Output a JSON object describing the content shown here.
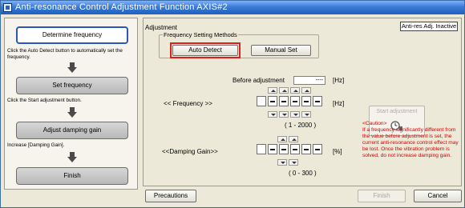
{
  "window": {
    "title": "Anti-resonance Control Adjustment Function AXIS#2"
  },
  "procedure": {
    "steps": [
      {
        "label": "Determine frequency",
        "note": "Click the Auto Detect button to automatically set the frequency."
      },
      {
        "label": "Set frequency",
        "note": "Click the Start adjustment button."
      },
      {
        "label": "Adjust damping gain",
        "note": "Increase [Damping Gain]."
      },
      {
        "label": "Finish",
        "note": ""
      }
    ]
  },
  "adjustment": {
    "title": "Adjustment",
    "status": "Anti-res Adj. Inactive",
    "freq_method_label": "Frequency Setting Methods",
    "auto_detect": "Auto Detect",
    "manual_set": "Manual Set",
    "before_label": "Before adjustment",
    "before_value": "----",
    "unit_hz": "[Hz]",
    "freq_label": "<< Frequency >>",
    "freq_range": "( 1 - 2000 )",
    "damping_label": "<<Damping Gain>>",
    "unit_pct": "[%]",
    "damping_range": "( 0 - 300 )",
    "start_label": "Start adjustment"
  },
  "caution": {
    "title": "<Caution>",
    "text": "If a frequency significantly different from the value before adjustment is set, the current anti-resonance control effect may be lost. Once the vibration problem is solved, do not increase damping gain."
  },
  "footer": {
    "precautions": "Precautions",
    "finish": "Finish",
    "cancel": "Cancel"
  },
  "colors": {
    "title_bar": "#2f68c8",
    "highlight": "#e41c1c",
    "caution": "#d40000",
    "active_step_border": "#2c56b8"
  }
}
